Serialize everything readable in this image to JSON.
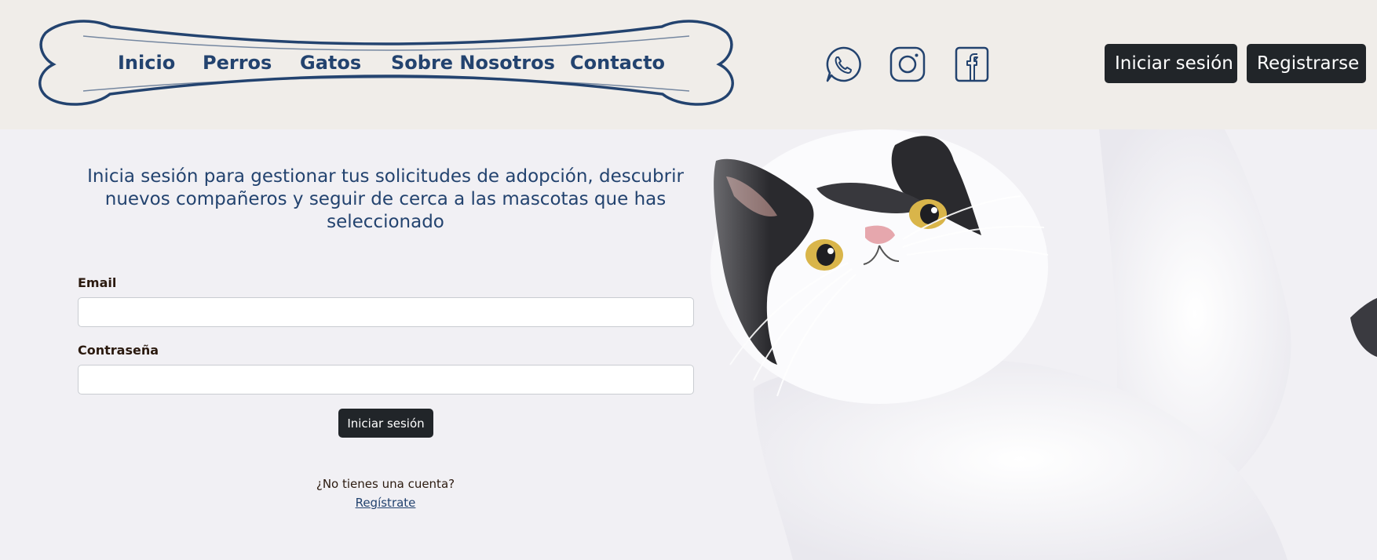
{
  "nav": {
    "links": [
      "Inicio",
      "Perros",
      "Gatos",
      "Sobre Nosotros",
      "Contacto"
    ]
  },
  "social": {
    "icons": [
      "whatsapp-icon",
      "instagram-icon",
      "facebook-icon"
    ],
    "color": "#23436f"
  },
  "header_actions": {
    "login_label": "Iniciar sesión",
    "register_label": "Registrarse"
  },
  "login": {
    "intro": "Inicia sesión para gestionar tus solicitudes de adopción, descubrir nuevos compañeros y seguir de cerca a las mascotas que has seleccionado",
    "email_label": "Email",
    "email_value": "",
    "password_label": "Contraseña",
    "password_value": "",
    "submit_label": "Iniciar sesión",
    "no_account_text": "¿No tienes una cuenta?",
    "register_link": "Regístrate"
  },
  "colors": {
    "header_bg": "#f0ede9",
    "brand_blue": "#23436f",
    "button_dark": "#212529"
  }
}
